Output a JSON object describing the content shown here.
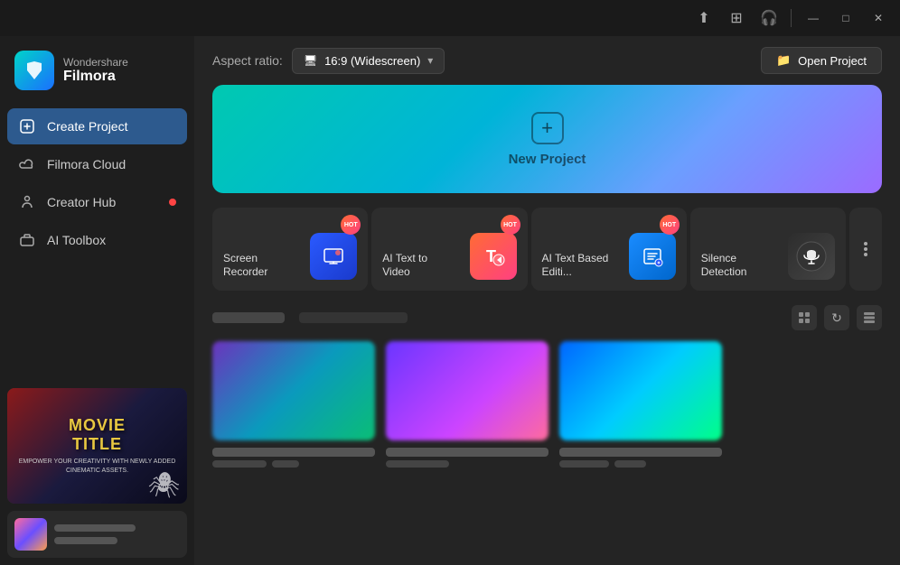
{
  "titlebar": {
    "controls": [
      "upload-icon",
      "grid-icon",
      "headphone-icon",
      "minimize-icon",
      "maximize-icon",
      "close-icon"
    ]
  },
  "sidebar": {
    "logo": {
      "brand": "Wondershare",
      "name": "Filmora"
    },
    "items": [
      {
        "id": "create-project",
        "label": "Create Project",
        "active": true,
        "dot": false
      },
      {
        "id": "filmora-cloud",
        "label": "Filmora Cloud",
        "active": false,
        "dot": false
      },
      {
        "id": "creator-hub",
        "label": "Creator Hub",
        "active": false,
        "dot": true
      },
      {
        "id": "ai-toolbox",
        "label": "AI Toolbox",
        "active": false,
        "dot": false
      }
    ]
  },
  "header": {
    "aspect_label": "Aspect ratio:",
    "aspect_value": "16:9 (Widescreen)",
    "open_project_label": "Open Project"
  },
  "new_project": {
    "label": "New Project"
  },
  "feature_cards": [
    {
      "id": "screen-recorder",
      "label": "Screen Recorder",
      "badge": "HOT",
      "icon": "🎥"
    },
    {
      "id": "ai-text-to-video",
      "label": "AI Text to Video",
      "badge": "HOT",
      "icon": "T"
    },
    {
      "id": "ai-text-based-editing",
      "label": "AI Text Based Editi...",
      "badge": "HOT",
      "icon": "⌨"
    },
    {
      "id": "silence-detection",
      "label": "Silence Detection",
      "badge": "",
      "icon": "🎧"
    }
  ],
  "recent": {
    "title1": "████████",
    "title2": "█████ ███ █████",
    "items": [
      {
        "id": 1,
        "title": "████████████",
        "meta1": "████ ████",
        "meta2": "███"
      },
      {
        "id": 2,
        "title": "████████ ████ ██████████",
        "meta1": "████",
        "meta2": ""
      },
      {
        "id": 3,
        "title": "████ ██████████",
        "meta1": "████ ████",
        "meta2": "███"
      }
    ]
  },
  "movie_thumb": {
    "title": "MOVIE\nTITLE",
    "subtitle": "EMPOWER YOUR\nCREATIVITY WITH NEWLY\nADDED CINEMATIC\nASSETS."
  }
}
